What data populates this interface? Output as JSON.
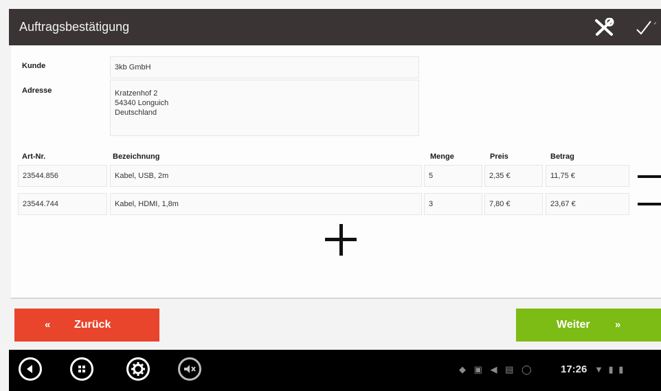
{
  "header": {
    "title": "Auftragsbestätigung"
  },
  "customer": {
    "kunde_label": "Kunde",
    "kunde_value": "3kb GmbH",
    "adresse_label": "Adresse",
    "address_lines": [
      "Kratzenhof 2",
      "54340 Longuich",
      "Deutschland"
    ]
  },
  "table": {
    "headers": {
      "art": "Art-Nr.",
      "bezeichnung": "Bezeichnung",
      "menge": "Menge",
      "preis": "Preis",
      "betrag": "Betrag"
    },
    "rows": [
      {
        "art": "23544.856",
        "bezeichnung": "Kabel, USB, 2m",
        "menge": "5",
        "preis": "2,35 €",
        "betrag": "11,75 €"
      },
      {
        "art": "23544.744",
        "bezeichnung": "Kabel, HDMI, 1,8m",
        "menge": "3",
        "preis": "7,80 €",
        "betrag": "23,67 €"
      }
    ]
  },
  "buttons": {
    "back_label": "Zurück",
    "back_icon": "«",
    "next_label": "Weiter",
    "next_icon": "»"
  },
  "colors": {
    "header_bg": "#3a3435",
    "back_button": "#e8452c",
    "next_button": "#7dbb15",
    "system_bar": "#000000"
  },
  "status_bar": {
    "time": "17:26"
  }
}
